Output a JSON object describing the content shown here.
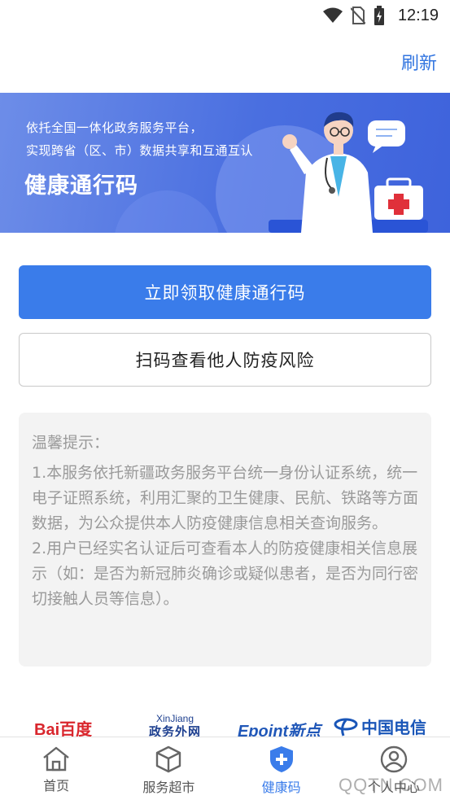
{
  "status_bar": {
    "time": "12:19",
    "icons": [
      "wifi-icon",
      "no-sim-icon",
      "battery-charging-icon"
    ]
  },
  "header": {
    "refresh_label": "刷新"
  },
  "banner": {
    "line1": "依托全国一体化政务服务平台，",
    "line2": "实现跨省（区、市）数据共享和互通互认",
    "title": "健康通行码",
    "illustration": "doctor-illustration"
  },
  "actions": {
    "primary_label": "立即领取健康通行码",
    "secondary_label": "扫码查看他人防疫风险"
  },
  "tips": {
    "title": "温馨提示：",
    "item1": "1.本服务依托新疆政务服务平台统一身份认证系统，统一电子证照系统，利用汇聚的卫生健康、民航、铁路等方面数据，为公众提供本人防疫健康信息相关查询服务。",
    "item2": "2.用户已经实名认证后可查看本人的防疫健康相关信息展示（如：是否为新冠肺炎确诊或疑似患者，是否为同行密切接触人员等信息）。"
  },
  "partners": {
    "baidu": "Bai百度",
    "xinjiang_en": "XinJiang",
    "xinjiang_cn": "政务外网",
    "epoint": "Epoint新点",
    "telecom": "中国电信"
  },
  "tabbar": {
    "items": [
      {
        "label": "首页",
        "icon": "home-icon"
      },
      {
        "label": "服务超市",
        "icon": "cube-icon"
      },
      {
        "label": "健康码",
        "icon": "shield-plus-icon",
        "active": true
      },
      {
        "label": "个人中心",
        "icon": "user-icon"
      }
    ]
  },
  "watermark": "QQTN.COM",
  "colors": {
    "accent": "#3a7cea",
    "refresh": "#3275e0",
    "banner_start": "#6d8de8",
    "banner_end": "#3e63dc",
    "tips_bg": "#f3f3f3"
  }
}
